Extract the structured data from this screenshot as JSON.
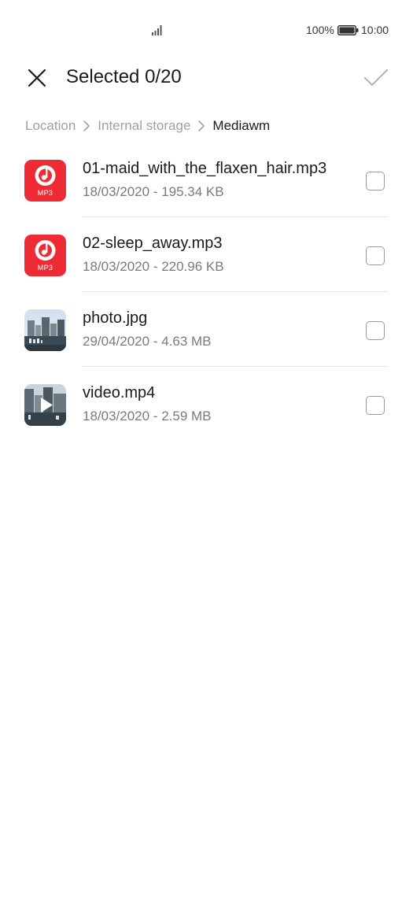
{
  "status_bar": {
    "battery_percent": "100%",
    "time": "10:00",
    "icons": [
      "signal-icon",
      "battery-icon"
    ]
  },
  "header": {
    "title": "Selected 0/20",
    "close_icon": "close-icon",
    "confirm_icon": "checkmark-icon"
  },
  "breadcrumb": {
    "items": [
      "Location",
      "Internal storage",
      "Mediawm"
    ],
    "separator_icon": "chevron-right-icon"
  },
  "files": [
    {
      "name": "01-maid_with_the_flaxen_hair.mp3",
      "meta": "18/03/2020 - 195.34 KB",
      "type_label": "MP3",
      "icon": "mp3-file-icon",
      "checked": false
    },
    {
      "name": "02-sleep_away.mp3",
      "meta": "18/03/2020 - 220.96 KB",
      "type_label": "MP3",
      "icon": "mp3-file-icon",
      "checked": false
    },
    {
      "name": "photo.jpg",
      "meta": "29/04/2020 - 4.63 MB",
      "icon": "photo-thumbnail",
      "checked": false
    },
    {
      "name": "video.mp4",
      "meta": "18/03/2020 - 2.59 MB",
      "icon": "video-thumbnail",
      "checked": false
    }
  ],
  "colors": {
    "mp3_accent": "#ee2b34",
    "text_primary": "#1a1a1a",
    "text_secondary": "#7a7a7a",
    "breadcrumb_inactive": "#a0a0a0"
  }
}
